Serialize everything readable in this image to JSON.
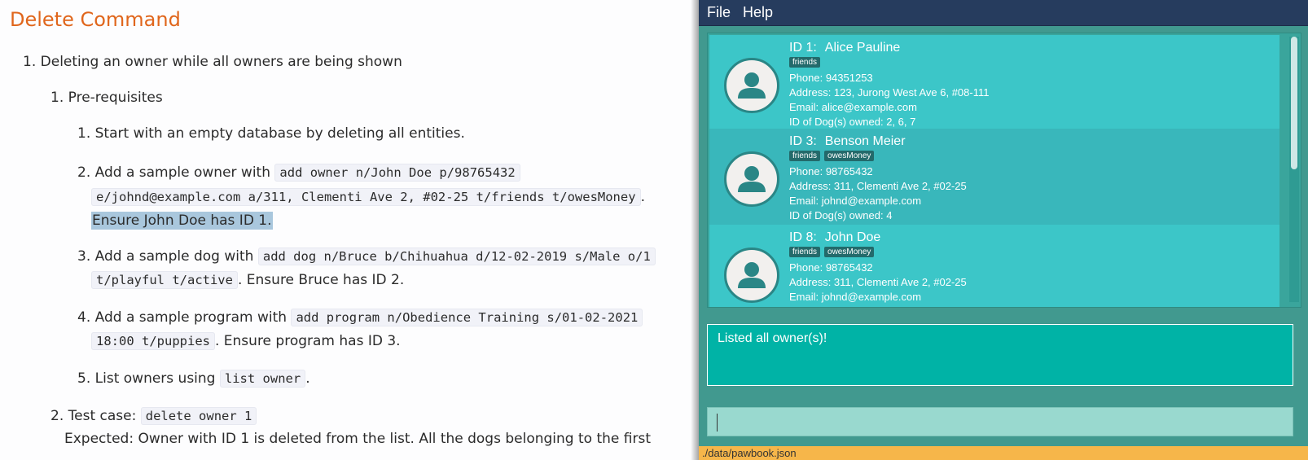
{
  "doc": {
    "heading": "Delete Command",
    "item1": {
      "num": "1.",
      "text": "Deleting an owner while all owners are being shown"
    },
    "pre": {
      "num": "1.",
      "text": "Pre-requisites"
    },
    "step1": {
      "num": "1.",
      "text": "Start with an empty database by deleting all entities."
    },
    "step2": {
      "num": "2.",
      "prefix": "Add a sample owner with ",
      "code_a": "add owner n/John Doe p/98765432",
      "code_b": "e/johnd@example.com a/311, Clementi Ave 2, #02-25 t/friends t/owesMoney",
      "suffix": ".",
      "highlight": "Ensure John Doe has ID 1."
    },
    "step3": {
      "num": "3.",
      "prefix": "Add a sample dog with ",
      "code_a": "add dog n/Bruce b/Chihuahua d/12-02-2019 s/Male o/1",
      "code_b": "t/playful t/active",
      "suffix": ". Ensure Bruce has ID 2."
    },
    "step4": {
      "num": "4.",
      "prefix": "Add a sample program with ",
      "code_a": "add program n/Obedience Training s/01-02-2021",
      "code_b": "18:00 t/puppies",
      "suffix": ". Ensure program has ID 3."
    },
    "step5": {
      "num": "5.",
      "prefix": "List owners using ",
      "code": "list owner",
      "suffix": "."
    },
    "test": {
      "num": "2.",
      "prefix": "Test case: ",
      "code": "delete owner 1"
    },
    "expected": "Expected: Owner with ID 1 is deleted from the list. All the dogs belonging to the first"
  },
  "app": {
    "menu": [
      "File",
      "Help"
    ],
    "owners": [
      {
        "id_label": "ID 1:",
        "name": "Alice Pauline",
        "tags": [
          "friends"
        ],
        "phone": "Phone: 94351253",
        "address": "Address: 123, Jurong West Ave 6, #08-111",
        "email": "Email: alice@example.com",
        "dogs": "ID of Dog(s) owned: 2, 6, 7"
      },
      {
        "id_label": "ID 3:",
        "name": "Benson Meier",
        "tags": [
          "friends",
          "owesMoney"
        ],
        "phone": "Phone: 98765432",
        "address": "Address: 311, Clementi Ave 2, #02-25",
        "email": "Email: johnd@example.com",
        "dogs": "ID of Dog(s) owned: 4"
      },
      {
        "id_label": "ID 8:",
        "name": "John Doe",
        "tags": [
          "friends",
          "owesMoney"
        ],
        "phone": "Phone: 98765432",
        "address": "Address: 311, Clementi Ave 2, #02-25",
        "email": "Email: johnd@example.com",
        "dogs": ""
      }
    ],
    "result": "Listed all owner(s)!",
    "command_value": "",
    "status": "./data/pawbook.json"
  }
}
